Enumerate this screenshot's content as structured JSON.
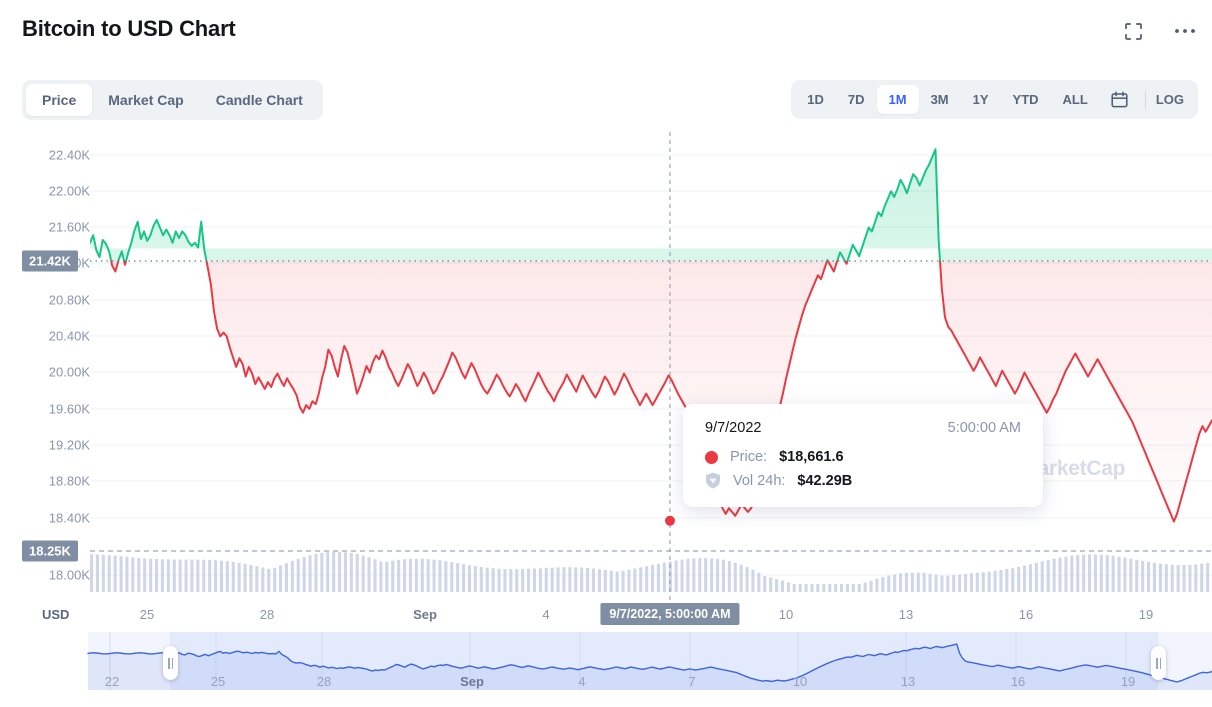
{
  "header": {
    "title": "Bitcoin to USD Chart",
    "expand_icon": "fullscreen-icon",
    "more_icon": "more-horizontal-icon"
  },
  "tabs": [
    {
      "label": "Price",
      "active": true
    },
    {
      "label": "Market Cap",
      "active": false
    },
    {
      "label": "Candle Chart",
      "active": false
    }
  ],
  "range_selector": {
    "options": [
      {
        "label": "1D",
        "active": false
      },
      {
        "label": "7D",
        "active": false
      },
      {
        "label": "1M",
        "active": true
      },
      {
        "label": "3M",
        "active": false
      },
      {
        "label": "1Y",
        "active": false
      },
      {
        "label": "YTD",
        "active": false
      },
      {
        "label": "ALL",
        "active": false
      }
    ],
    "calendar_icon": "calendar-icon",
    "log_label": "LOG"
  },
  "watermark": "CoinMarketCap",
  "tooltip": {
    "date": "9/7/2022",
    "time": "5:00:00 AM",
    "price_label": "Price:",
    "price_value": "$18,661.6",
    "volume_label": "Vol 24h:",
    "volume_value": "$42.29B",
    "price_marker_icon": "red-dot-icon",
    "volume_marker_icon": "shield-volume-icon"
  },
  "axis_badges": {
    "price_badge": "21.42K",
    "volume_badge": "18.25K"
  },
  "colors": {
    "up": "#16c784",
    "down": "#ea3943",
    "accent": "#3861fb",
    "axis_text": "#8a96ab",
    "badge_bg": "#7f8ea3",
    "volume_bar": "#c7d0e3",
    "navigator_line": "#3d63e0"
  },
  "chart_data": {
    "type": "line",
    "title": "Bitcoin to USD Chart",
    "xlabel": "USD",
    "ylabel": "",
    "ylim": [
      17900,
      22600
    ],
    "y_ticks": [
      "22.40K",
      "22.00K",
      "21.60K",
      "21.20K",
      "20.80K",
      "20.40K",
      "20.00K",
      "19.60K",
      "19.20K",
      "18.80K",
      "18.40K",
      "18.00K"
    ],
    "y_tick_values": [
      22400,
      22000,
      21600,
      21200,
      20800,
      20400,
      20000,
      19600,
      19200,
      18800,
      18400,
      18000
    ],
    "x_ticks": [
      "25",
      "28",
      "Sep",
      "4",
      "10",
      "13",
      "16",
      "19"
    ],
    "grid": true,
    "legend": "none",
    "reference_lines": [
      {
        "label": "21.42K",
        "value": 21420,
        "style": "dotted"
      },
      {
        "label": "18.25K",
        "value": 18250,
        "style": "dashed"
      }
    ],
    "highlight_point": {
      "x_label": "9/7/2022, 5:00:00 AM",
      "price": 18661.6,
      "volume": "$42.29B"
    },
    "series": [
      {
        "name": "Price (USD)",
        "values": [
          21480,
          21560,
          21400,
          21330,
          21510,
          21470,
          21390,
          21240,
          21180,
          21300,
          21390,
          21250,
          21370,
          21480,
          21610,
          21700,
          21520,
          21600,
          21500,
          21560,
          21660,
          21720,
          21640,
          21560,
          21620,
          21560,
          21480,
          21600,
          21530,
          21600,
          21560,
          21490,
          21450,
          21480,
          21430,
          21700,
          21400,
          21230,
          21050,
          20760,
          20580,
          20500,
          20540,
          20500,
          20380,
          20280,
          20180,
          20270,
          20210,
          20080,
          20180,
          20110,
          20000,
          20070,
          20010,
          19950,
          20020,
          19970,
          20060,
          20110,
          20040,
          19980,
          20060,
          20000,
          19950,
          19880,
          19760,
          19700,
          19780,
          19740,
          19820,
          19790,
          19900,
          20060,
          20180,
          20360,
          20300,
          20180,
          20080,
          20260,
          20400,
          20330,
          20200,
          20060,
          19900,
          19980,
          20080,
          20190,
          20120,
          20230,
          20300,
          20260,
          20350,
          20280,
          20180,
          20120,
          20040,
          19980,
          20050,
          20130,
          20210,
          20150,
          20060,
          19980,
          20040,
          20120,
          20060,
          19980,
          19900,
          19940,
          20020,
          20080,
          20160,
          20240,
          20330,
          20280,
          20200,
          20120,
          20060,
          20140,
          20220,
          20160,
          20080,
          20000,
          19940,
          19900,
          19960,
          20030,
          20100,
          20050,
          19980,
          19920,
          19870,
          19930,
          20000,
          19950,
          19880,
          19820,
          19900,
          19970,
          20040,
          20120,
          20060,
          19990,
          19930,
          19880,
          19820,
          19900,
          19960,
          20020,
          20100,
          20040,
          19980,
          19920,
          20010,
          20090,
          20030,
          19970,
          19910,
          19860,
          19920,
          20000,
          20080,
          20030,
          19960,
          19890,
          19950,
          20030,
          20110,
          20050,
          19980,
          19910,
          19850,
          19780,
          19840,
          19900,
          19840,
          19780,
          19840,
          19900,
          19960,
          20020,
          20090,
          20040,
          19970,
          19900,
          19840,
          19780,
          19720,
          19660,
          19600,
          19520,
          19400,
          19280,
          19160,
          19040,
          18940,
          18860,
          18780,
          18700,
          18640,
          18700,
          18660,
          18620,
          18680,
          18740,
          18700,
          18661,
          18700,
          18780,
          18860,
          18940,
          19040,
          19160,
          19300,
          19440,
          19600,
          19760,
          19900,
          20060,
          20200,
          20340,
          20480,
          20600,
          20720,
          20820,
          20900,
          20980,
          21060,
          21140,
          21100,
          21200,
          21300,
          21240,
          21180,
          21280,
          21380,
          21320,
          21260,
          21360,
          21460,
          21400,
          21340,
          21440,
          21540,
          21640,
          21600,
          21700,
          21800,
          21760,
          21860,
          21940,
          22020,
          21960,
          22040,
          22140,
          22080,
          22000,
          22100,
          22200,
          22160,
          22080,
          22160,
          22240,
          22300,
          22380,
          22460,
          21500,
          21000,
          20700,
          20600,
          20560,
          20500,
          20440,
          20380,
          20320,
          20260,
          20200,
          20140,
          20200,
          20280,
          20220,
          20160,
          20100,
          20040,
          19980,
          20060,
          20140,
          20080,
          20020,
          19960,
          19900,
          19960,
          20040,
          20120,
          20060,
          20000,
          19940,
          19880,
          19820,
          19760,
          19700,
          19760,
          19840,
          19900,
          19980,
          20060,
          20140,
          20200,
          20260,
          20320,
          20260,
          20200,
          20140,
          20080,
          20140,
          20200,
          20260,
          20200,
          20140,
          20080,
          20020,
          19960,
          19900,
          19840,
          19780,
          19720,
          19660,
          19600,
          19520,
          19440,
          19360,
          19280,
          19200,
          19120,
          19040,
          18960,
          18880,
          18800,
          18720,
          18640,
          18560,
          18640,
          18760,
          18880,
          19000,
          19120,
          19240,
          19360,
          19480,
          19560,
          19500,
          19560,
          19620
        ]
      }
    ],
    "volume": {
      "name": "Vol 24h",
      "unit": "USD",
      "highlight_value": "$42.29B"
    },
    "navigator": {
      "x_ticks": [
        "22",
        "25",
        "28",
        "Sep",
        "4",
        "7",
        "10",
        "13",
        "16",
        "19"
      ],
      "selection_start_label": "25",
      "selection_end_label": "19"
    }
  }
}
